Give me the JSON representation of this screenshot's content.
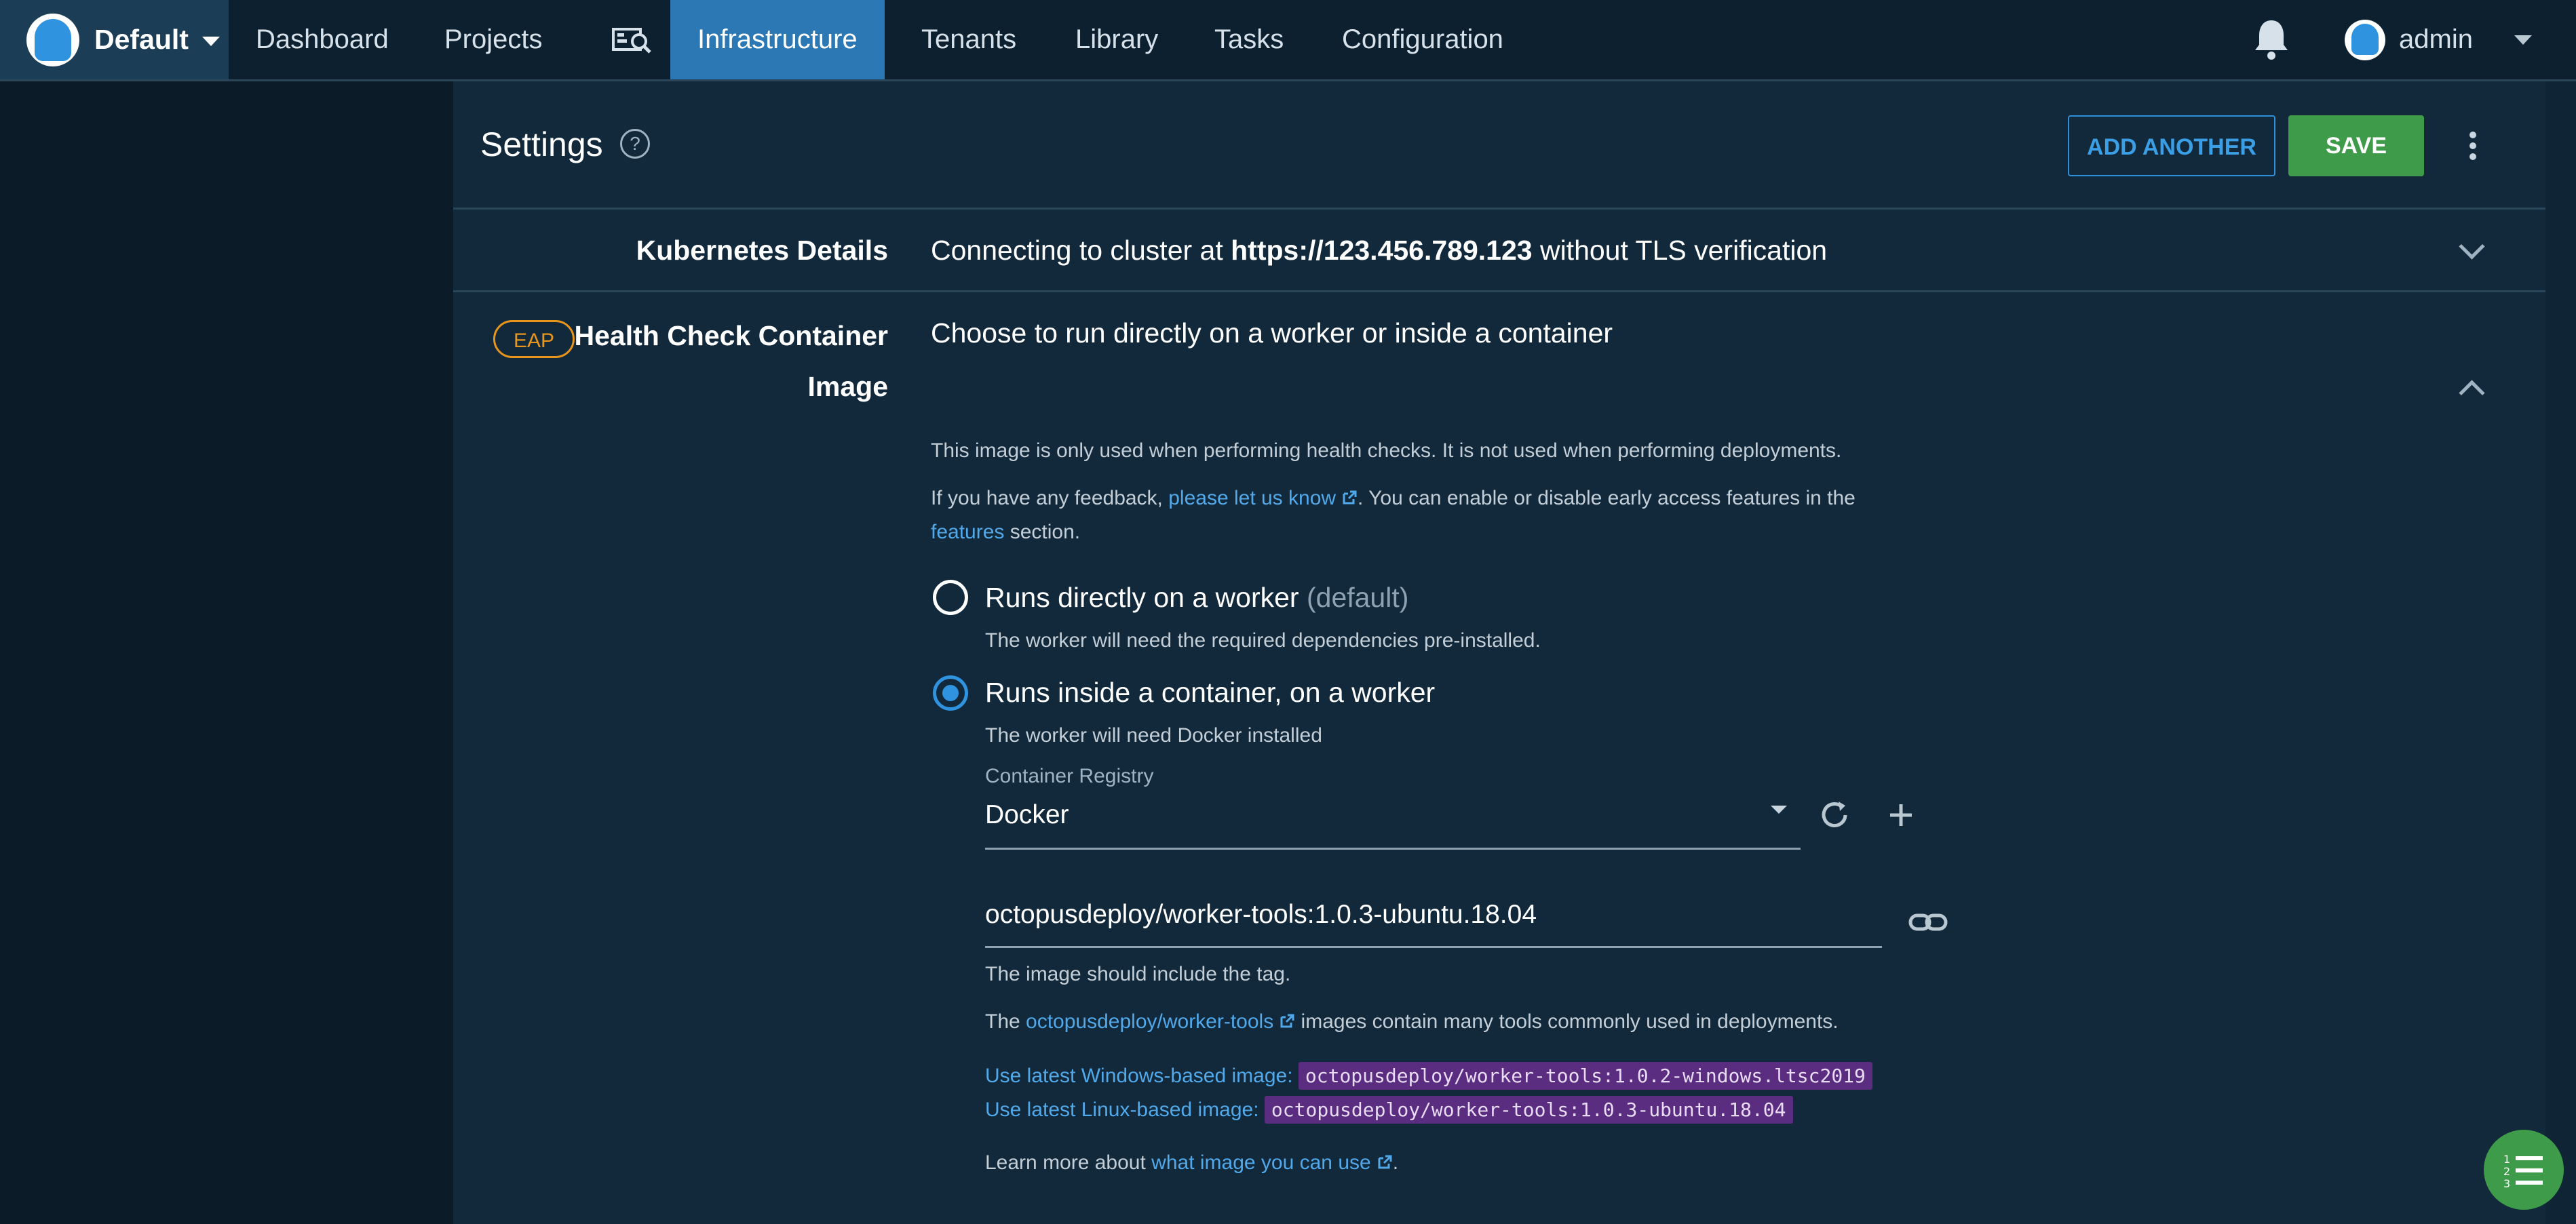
{
  "nav": {
    "space_name": "Default",
    "items": [
      "Dashboard",
      "Projects",
      "Infrastructure",
      "Tenants",
      "Library",
      "Tasks",
      "Configuration"
    ],
    "active": "Infrastructure",
    "user_name": "admin"
  },
  "settings": {
    "title": "Settings",
    "add_another_label": "ADD ANOTHER",
    "save_label": "SAVE"
  },
  "kubernetes": {
    "label": "Kubernetes Details",
    "summary_prefix": "Connecting to cluster at ",
    "cluster_url": "https://123.456.789.123",
    "summary_suffix": " without TLS verification"
  },
  "health_check": {
    "badge": "EAP",
    "label_line1": "Health Check Container",
    "label_line2": "Image",
    "summary": "Choose to run directly on a worker or inside a container",
    "info": "This image is only used when performing health checks. It is not used when performing deployments.",
    "feedback_prefix": "If you have any feedback, ",
    "feedback_link": "please let us know",
    "feedback_suffix": ". You can enable or disable early access features in the",
    "features_link": "features",
    "features_suffix": " section.",
    "option_direct_label": "Runs directly on a worker",
    "option_direct_default": "(default)",
    "option_direct_help": "The worker will need the required dependencies pre-installed.",
    "option_container_label": "Runs inside a container, on a worker",
    "option_container_help": "The worker will need Docker installed",
    "selected_option": "container",
    "registry_label": "Container Registry",
    "registry_value": "Docker",
    "image_value": "octopusdeploy/worker-tools:1.0.3-ubuntu.18.04",
    "image_help": "The image should include the tag.",
    "tools_prefix": "The ",
    "tools_link": "octopusdeploy/worker-tools",
    "tools_suffix": " images contain many tools commonly used in deployments.",
    "windows_label": "Use latest Windows-based image:",
    "windows_image": "octopusdeploy/worker-tools:1.0.2-windows.ltsc2019",
    "linux_label": "Use latest Linux-based image:",
    "linux_image": "octopusdeploy/worker-tools:1.0.3-ubuntu.18.04",
    "learn_prefix": "Learn more about ",
    "learn_link": "what image you can use",
    "learn_suffix": "."
  },
  "colors": {
    "accent": "#2c78b5",
    "save": "#3d9b49",
    "link": "#52a9ea",
    "eap": "#e8951c",
    "code_chip": "#5a2d80"
  },
  "icons": [
    "octopus-logo-icon",
    "caret-down-icon",
    "project-search-icon",
    "bell-icon",
    "help-circle-icon",
    "more-vertical-icon",
    "chevron-down-icon",
    "chevron-up-icon",
    "external-link-icon",
    "refresh-icon",
    "plus-icon",
    "link-icon",
    "task-list-icon"
  ]
}
